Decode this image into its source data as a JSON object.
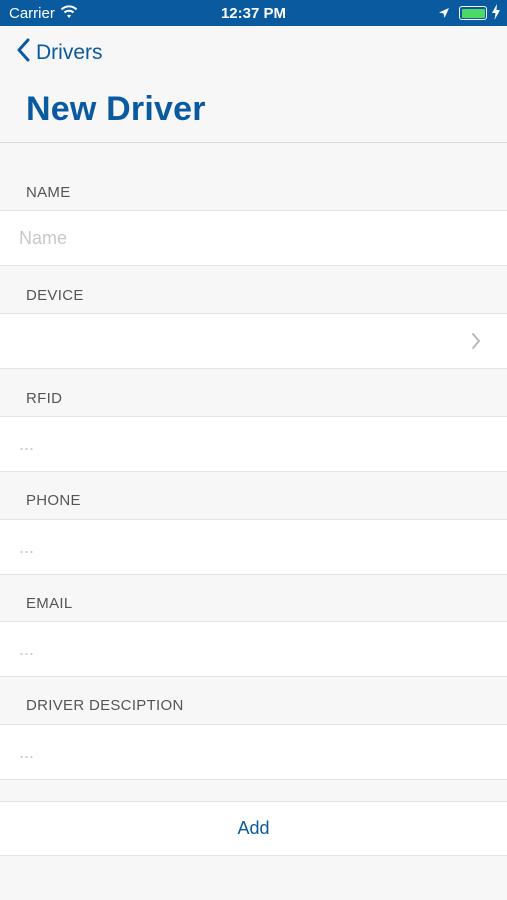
{
  "status_bar": {
    "carrier": "Carrier",
    "time": "12:37 PM",
    "battery_level": 1.0,
    "icons": [
      "wifi-icon",
      "location-arrow-icon",
      "battery-icon",
      "charging-bolt-icon"
    ]
  },
  "nav": {
    "back_label": "Drivers",
    "title": "New Driver"
  },
  "form": {
    "name": {
      "header": "NAME",
      "placeholder": "Name",
      "value": ""
    },
    "device": {
      "header": "DEVICE",
      "value": ""
    },
    "rfid": {
      "header": "RFID",
      "placeholder": "...",
      "value": ""
    },
    "phone": {
      "header": "PHONE",
      "placeholder": "...",
      "value": ""
    },
    "email": {
      "header": "EMAIL",
      "placeholder": "...",
      "value": ""
    },
    "description": {
      "header": "DRIVER DESCIPTION",
      "placeholder": "...",
      "value": ""
    }
  },
  "actions": {
    "add_label": "Add"
  },
  "colors": {
    "accent": "#0a5aa0",
    "background": "#f7f7f7",
    "cell": "#ffffff",
    "placeholder": "#c7c7cc",
    "battery": "#4cd964"
  }
}
